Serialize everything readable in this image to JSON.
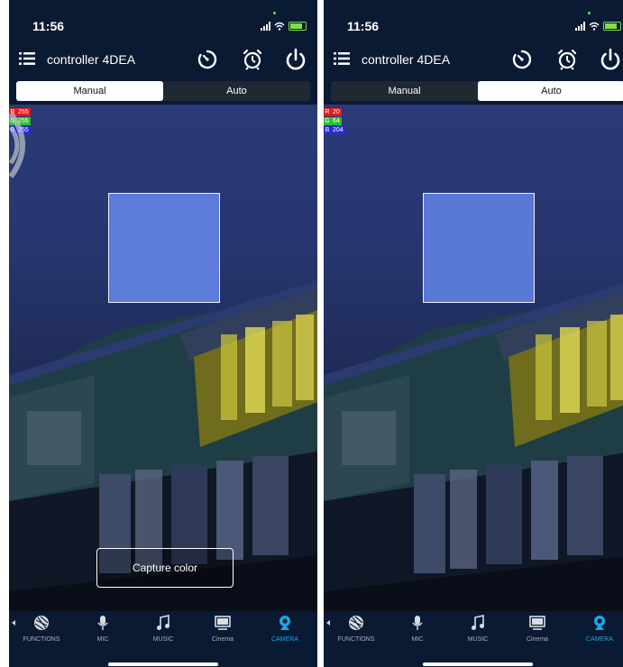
{
  "status": {
    "time": "11:56"
  },
  "header": {
    "title": "controller 4DEA"
  },
  "tabs": {
    "manual": "Manual",
    "auto": "Auto"
  },
  "screens": {
    "left": {
      "active_tab": "manual",
      "rgb": {
        "r_label": "R",
        "r": "255",
        "g_label": "G",
        "g": "255",
        "b_label": "B",
        "b": "255"
      },
      "sample_color": "#5d7bd8",
      "capture_label": "Capture color"
    },
    "right": {
      "active_tab": "auto",
      "rgb": {
        "r_label": "R",
        "r": "20",
        "g_label": "G",
        "g": "64",
        "b_label": "B",
        "b": "204"
      },
      "sample_color": "#5a78d6"
    }
  },
  "nav": {
    "items": [
      {
        "label": "FUNCTIONS",
        "icon": "functions-icon"
      },
      {
        "label": "MIC",
        "icon": "mic-icon"
      },
      {
        "label": "MUSIC",
        "icon": "music-icon"
      },
      {
        "label": "Cinema",
        "icon": "cinema-icon"
      },
      {
        "label": "CAMERA",
        "icon": "camera-icon"
      }
    ],
    "active": "CAMERA"
  },
  "colors": {
    "background": "#0b1a33",
    "accent": "#1ea7e8",
    "r": "#e11a1a",
    "g": "#28c228",
    "b": "#2a2ad6"
  }
}
